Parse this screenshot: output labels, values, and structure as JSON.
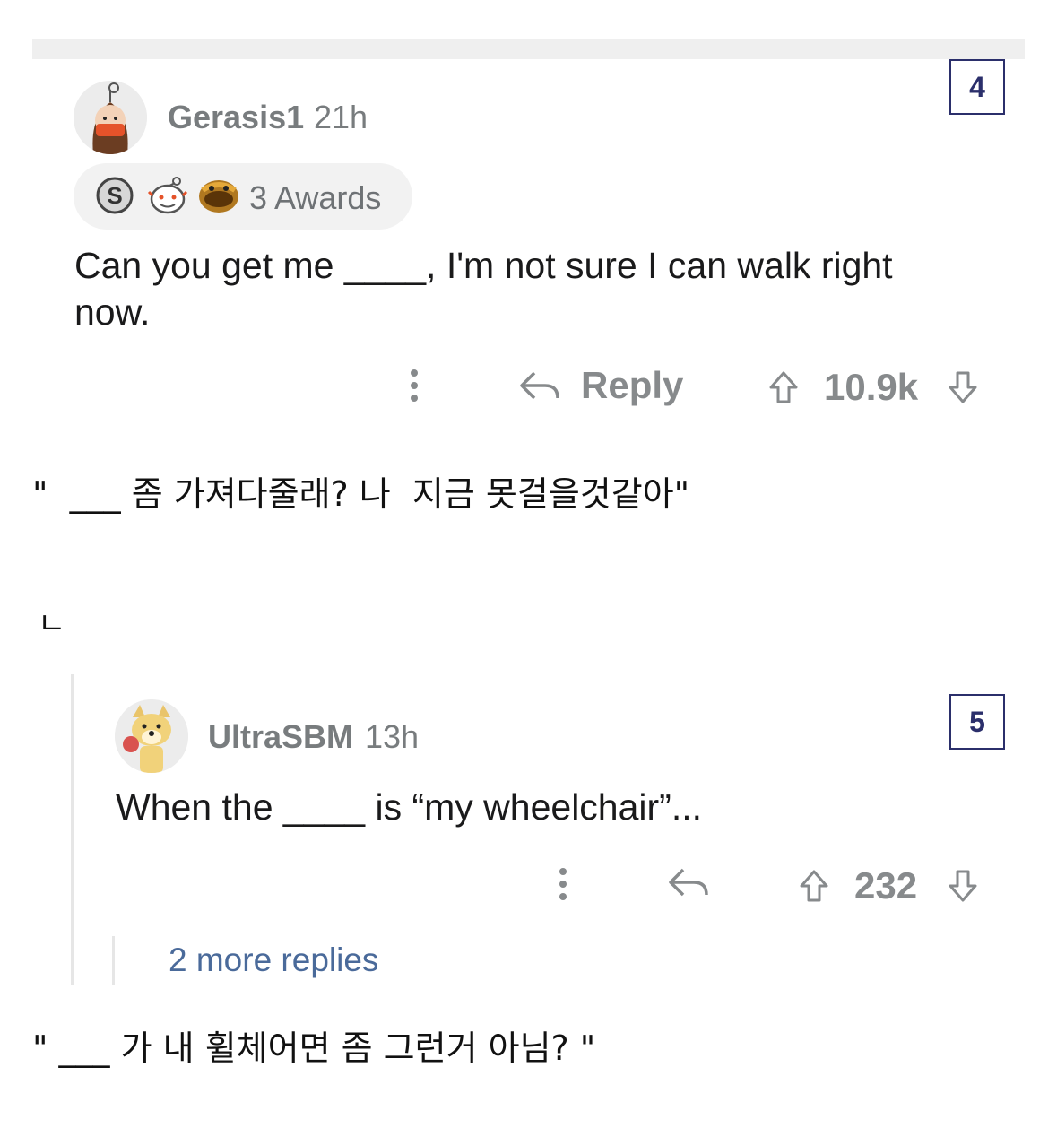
{
  "comment1": {
    "badge": "4",
    "username": "Gerasis1",
    "time": "21h",
    "awards_label": "3 Awards",
    "award_icons": [
      "silver-award-icon",
      "wholesome-award-icon",
      "laughing-award-icon"
    ],
    "body": "Can you get me ____, I'm not sure I can walk right now.",
    "reply_label": "Reply",
    "score": "10.9k"
  },
  "caption1": "\"  ___ 좀 가져다줄래? 나  지금 못걸을것같아\"",
  "reply_marker": "ㄴ",
  "comment2": {
    "badge": "5",
    "username": "UltraSBM",
    "time": "13h",
    "body": "When the ____ is “my wheelchair”...",
    "score": "232",
    "more_replies": "2 more replies"
  },
  "caption2": "\" ___ 가 내 휠체어면 좀 그런거 아님? \"",
  "colors": {
    "meta_gray": "#787c7e",
    "badge_border": "#2b2f6b",
    "link_blue": "#4a6a9a",
    "pill_bg": "#f2f2f2"
  }
}
